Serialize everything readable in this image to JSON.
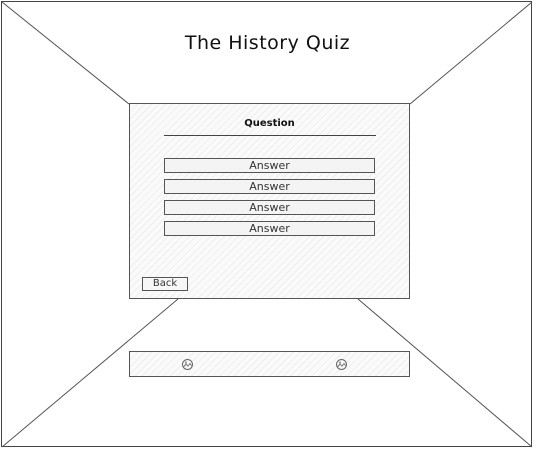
{
  "header": {
    "title": "The History Quiz"
  },
  "quiz": {
    "question": "Question",
    "answers": [
      "Answer",
      "Answer",
      "Answer",
      "Answer"
    ],
    "back_label": "Back"
  },
  "bottom_bar": {
    "icons": [
      "left-image-icon",
      "right-image-icon"
    ]
  },
  "colors": {
    "line": "#444444",
    "panel_fill": "#fafafa"
  }
}
